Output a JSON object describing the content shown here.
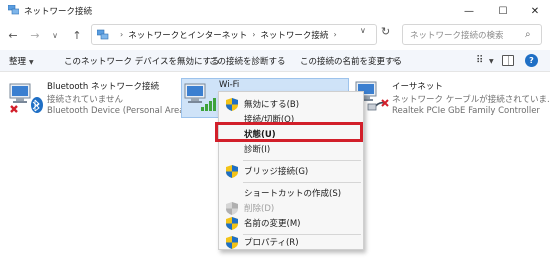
{
  "window": {
    "title": "ネットワーク接続"
  },
  "address": {
    "crumbs": [
      "ネットワークとインターネット",
      "ネットワーク接続"
    ],
    "search_placeholder": "ネットワーク接続の検索"
  },
  "commands": {
    "organize": "整理",
    "disable": "このネットワーク デバイスを無効にする",
    "diagnose": "この接続を診断する",
    "rename": "この接続の名前を変更する"
  },
  "connections": [
    {
      "name": "Bluetooth ネットワーク接続",
      "status": "接続されていません",
      "device": "Bluetooth Device (Personal Area ..."
    },
    {
      "name": "Wi-Fi",
      "status": "",
      "device": ""
    },
    {
      "name": "イーサネット",
      "status": "ネットワーク ケーブルが接続されていま...",
      "device": "Realtek PCIe GbE Family Controller"
    }
  ],
  "context_menu": {
    "disable": "無効にする(B)",
    "connect": "接続/切断(O)",
    "status": "状態(U)",
    "diagnose": "診断(I)",
    "bridge": "ブリッジ接続(G)",
    "shortcut": "ショートカットの作成(S)",
    "delete": "削除(D)",
    "rename": "名前の変更(M)",
    "properties": "プロパティ(R)"
  },
  "colors": {
    "highlight": "#d21f2a",
    "selection": "#cfe3f8",
    "accent": "#1f6fc5"
  }
}
